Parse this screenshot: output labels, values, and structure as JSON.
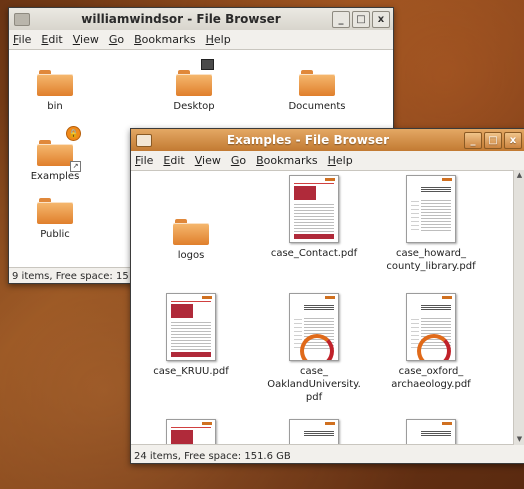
{
  "back_window": {
    "title": "williamwindsor - File Browser",
    "menu": [
      "File",
      "Edit",
      "View",
      "Go",
      "Bookmarks",
      "Help"
    ],
    "items": [
      {
        "label": "bin",
        "icon": "folder-icon"
      },
      {
        "label": "Desktop",
        "icon": "folder-icon"
      },
      {
        "label": "Documents",
        "icon": "folder-icon"
      },
      {
        "label": "Examples",
        "icon": "folder-icon"
      },
      {
        "label": "Public",
        "icon": "folder-icon"
      }
    ],
    "status": "9 items, Free space: 15"
  },
  "front_window": {
    "title": "Examples - File Browser",
    "menu": [
      "File",
      "Edit",
      "View",
      "Go",
      "Bookmarks",
      "Help"
    ],
    "items": [
      {
        "label": "logos",
        "icon": "folder-icon"
      },
      {
        "label": "case_Contact.pdf",
        "icon": "pdf-icon"
      },
      {
        "label": "case_howard_\ncounty_library.pdf",
        "icon": "pdf-icon"
      },
      {
        "label": "case_KRUU.pdf",
        "icon": "pdf-icon"
      },
      {
        "label": "case_\nOaklandUniversity.\npdf",
        "icon": "pdf-icon"
      },
      {
        "label": "case_oxford_\narchaeology.pdf",
        "icon": "pdf-icon"
      }
    ],
    "status": "24 items, Free space: 151.6 GB"
  },
  "window_buttons": {
    "minimize": "_",
    "maximize": "□",
    "close": "x"
  },
  "colors": {
    "accent": "#d98a3c",
    "folder": "#f0a050"
  }
}
